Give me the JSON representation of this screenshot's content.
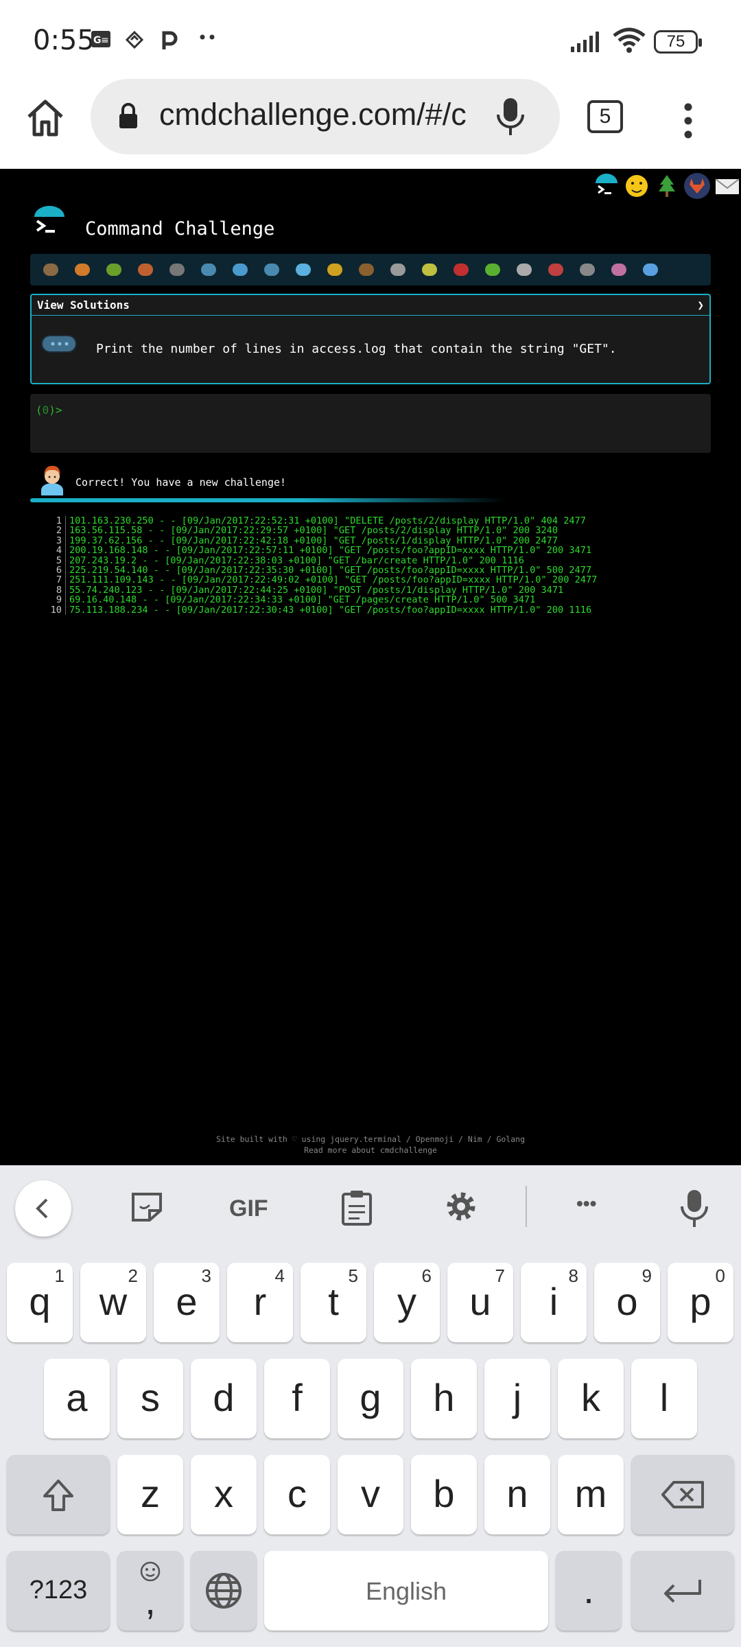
{
  "status_bar": {
    "time": "0:55",
    "battery": "75",
    "icons": [
      "gmail-icon",
      "layers-icon",
      "parking-icon",
      "more-dots-icon",
      "signal-icon",
      "wifi-icon",
      "battery-icon"
    ]
  },
  "browser": {
    "url": "cmdchallenge.com/#/c",
    "tab_count": "5"
  },
  "site": {
    "title": "Command Challenge",
    "top_icons": [
      "terminal-icon",
      "emoji-icon",
      "tree-icon",
      "gitlab-icon",
      "mail-icon"
    ],
    "view_solutions_label": "View Solutions",
    "chevron": "❯",
    "task": "Print the number of lines in access.log that contain the string \"GET\".",
    "prompt_prefix": "(",
    "prompt_num": "0",
    "prompt_suffix": ")>",
    "feedback": "Correct! You have a new challenge!",
    "log_lines": [
      {
        "n": "1",
        "t": "101.163.230.250 - - [09/Jan/2017:22:52:31 +0100] \"DELETE /posts/2/display HTTP/1.0\" 404 2477"
      },
      {
        "n": "2",
        "t": "163.56.115.58 - - [09/Jan/2017:22:29:57 +0100] \"GET /posts/2/display HTTP/1.0\" 200 3240"
      },
      {
        "n": "3",
        "t": "199.37.62.156 - - [09/Jan/2017:22:42:18 +0100] \"GET /posts/1/display HTTP/1.0\" 200 2477"
      },
      {
        "n": "4",
        "t": "200.19.168.148 - - [09/Jan/2017:22:57:11 +0100] \"GET /posts/foo?appID=xxxx HTTP/1.0\" 200 3471"
      },
      {
        "n": "5",
        "t": "207.243.19.2 - - [09/Jan/2017:22:38:03 +0100] \"GET /bar/create HTTP/1.0\" 200 1116"
      },
      {
        "n": "6",
        "t": "225.219.54.140 - - [09/Jan/2017:22:35:30 +0100] \"GET /posts/foo?appID=xxxx HTTP/1.0\" 500 2477"
      },
      {
        "n": "7",
        "t": "251.111.109.143 - - [09/Jan/2017:22:49:02 +0100] \"GET /posts/foo?appID=xxxx HTTP/1.0\" 200 2477"
      },
      {
        "n": "8",
        "t": "55.74.240.123 - - [09/Jan/2017:22:44:25 +0100] \"POST /posts/1/display HTTP/1.0\" 200 3471"
      },
      {
        "n": "9",
        "t": "69.16.40.148 - - [09/Jan/2017:22:34:33 +0100] \"GET /pages/create HTTP/1.0\" 500 3471"
      },
      {
        "n": "10",
        "t": "75.113.188.234 - - [09/Jan/2017:22:30:43 +0100] \"GET /posts/foo?appID=xxxx HTTP/1.0\" 200 1116"
      }
    ],
    "footer_line1": "Site built with ♡ using jquery.terminal / Openmoji / Nim / Golang",
    "footer_line2": "Read more about cmdchallenge",
    "emoji_bar_count": 20
  },
  "keyboard": {
    "toolbar": {
      "gif": "GIF",
      "more": "•••"
    },
    "row1": [
      {
        "c": "q",
        "s": "1"
      },
      {
        "c": "w",
        "s": "2"
      },
      {
        "c": "e",
        "s": "3"
      },
      {
        "c": "r",
        "s": "4"
      },
      {
        "c": "t",
        "s": "5"
      },
      {
        "c": "y",
        "s": "6"
      },
      {
        "c": "u",
        "s": "7"
      },
      {
        "c": "i",
        "s": "8"
      },
      {
        "c": "o",
        "s": "9"
      },
      {
        "c": "p",
        "s": "0"
      }
    ],
    "row2": [
      "a",
      "s",
      "d",
      "f",
      "g",
      "h",
      "j",
      "k",
      "l"
    ],
    "row3": [
      "z",
      "x",
      "c",
      "v",
      "b",
      "n",
      "m"
    ],
    "symbols_label": "?123",
    "comma_label": ",",
    "space_label": "English",
    "period_label": "."
  }
}
